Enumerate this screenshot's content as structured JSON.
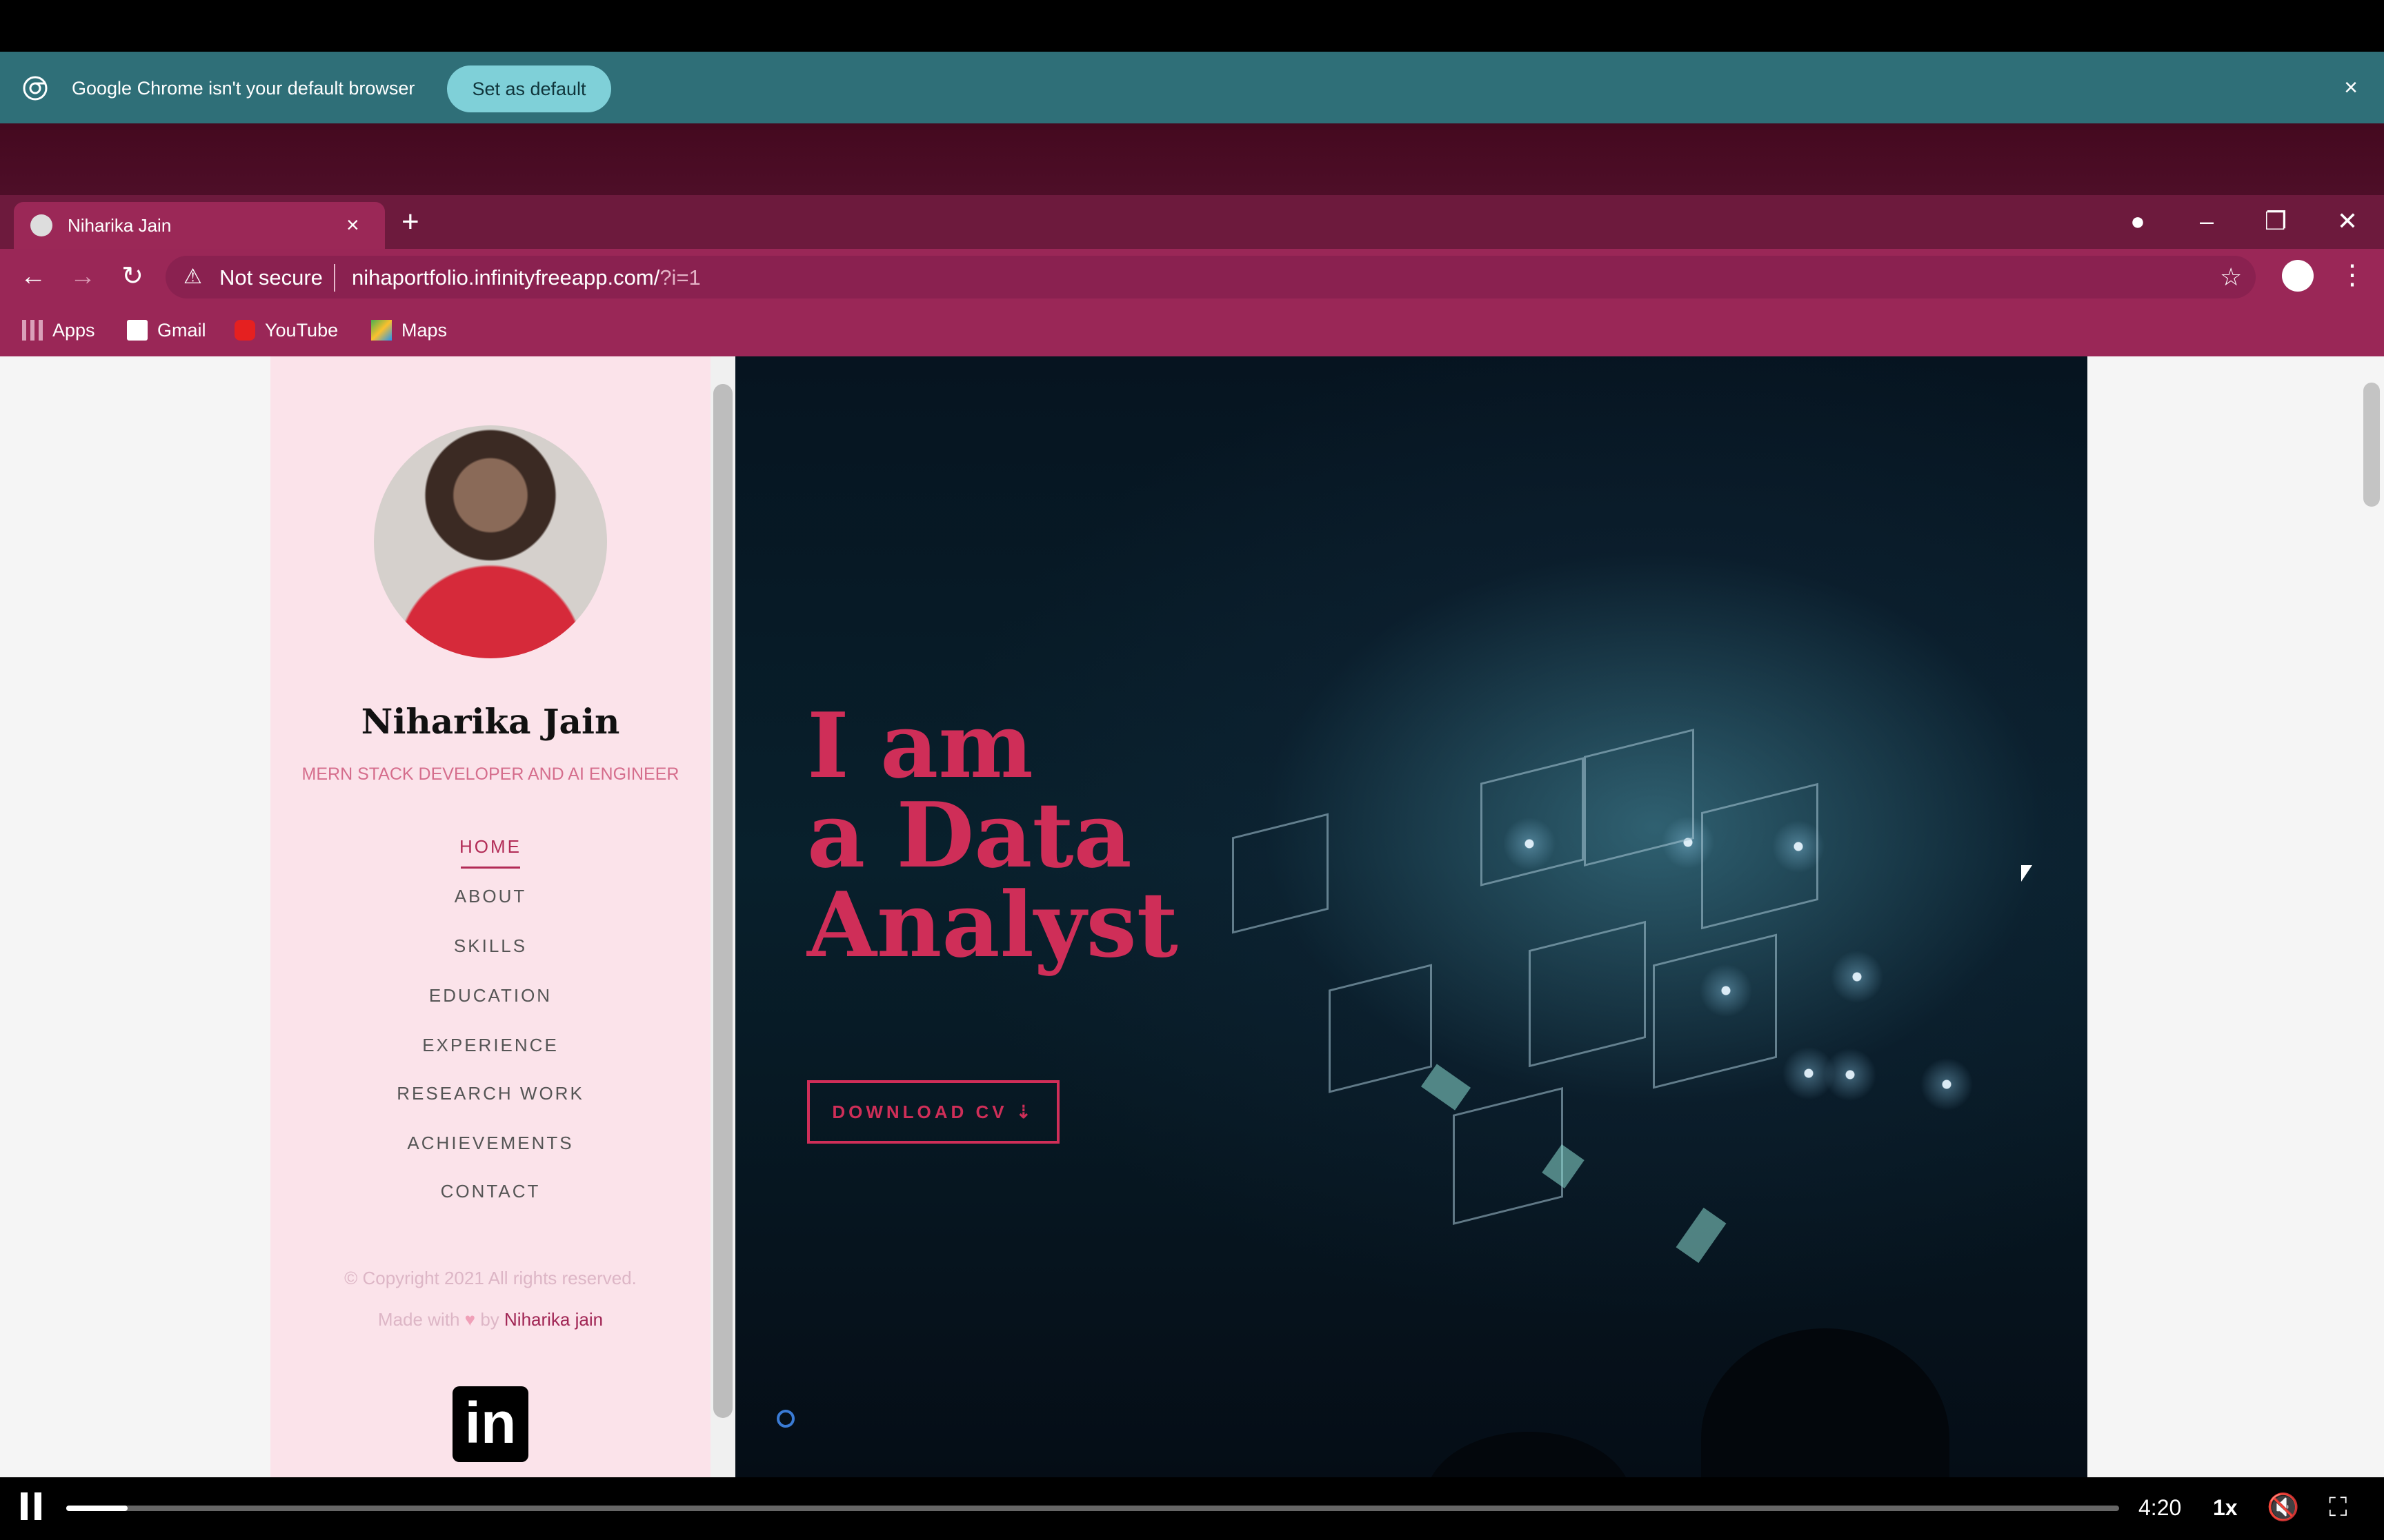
{
  "banner": {
    "message": "Google Chrome isn't your default browser",
    "set_default_label": "Set as default",
    "close_icon": "×"
  },
  "browser": {
    "tab_title": "Niharika Jain",
    "tab_close": "×",
    "new_tab": "+",
    "back": "←",
    "forward": "→",
    "reload": "↻",
    "security_icon": "⚠",
    "security_label": "Not secure",
    "url": "nihaportfolio.infinityfreeapp.com/",
    "url_query": "?i=1",
    "star_icon": "☆",
    "menu_icon": "⋮",
    "minimize": "–",
    "restore": "❐",
    "close": "✕",
    "bookmarks": [
      {
        "label": "Apps",
        "icon": "apps-grid-icon"
      },
      {
        "label": "Gmail",
        "icon": "gmail-icon"
      },
      {
        "label": "YouTube",
        "icon": "youtube-icon"
      },
      {
        "label": "Maps",
        "icon": "maps-icon"
      }
    ]
  },
  "profile": {
    "name": "Niharika Jain",
    "role": "MERN STACK DEVELOPER AND AI ENGINEER"
  },
  "nav": {
    "items": [
      "HOME",
      "ABOUT",
      "SKILLS",
      "EDUCATION",
      "EXPERIENCE",
      "RESEARCH WORK",
      "ACHIEVEMENTS",
      "CONTACT"
    ],
    "active": "HOME"
  },
  "footer": {
    "copyright": "© Copyright 2021 All rights reserved.",
    "made_with": "Made with",
    "heart": "♥",
    "by": "by",
    "author": "Niharika jain",
    "linkedin": "in"
  },
  "hero": {
    "line1": "I am",
    "line2": "a Data",
    "line3": "Analyst",
    "cv_button": "DOWNLOAD CV ⇣"
  },
  "player": {
    "time": "4:20",
    "speed": "1x",
    "progress_fraction": 0.03,
    "mute_icon": "🔇",
    "fullscreen_icon": "⛶"
  },
  "colors": {
    "accent": "#cf2e58",
    "sidebar_bg": "#fbe3ea",
    "browser_frame": "#9a2757",
    "banner_bg": "#2f6f78"
  }
}
